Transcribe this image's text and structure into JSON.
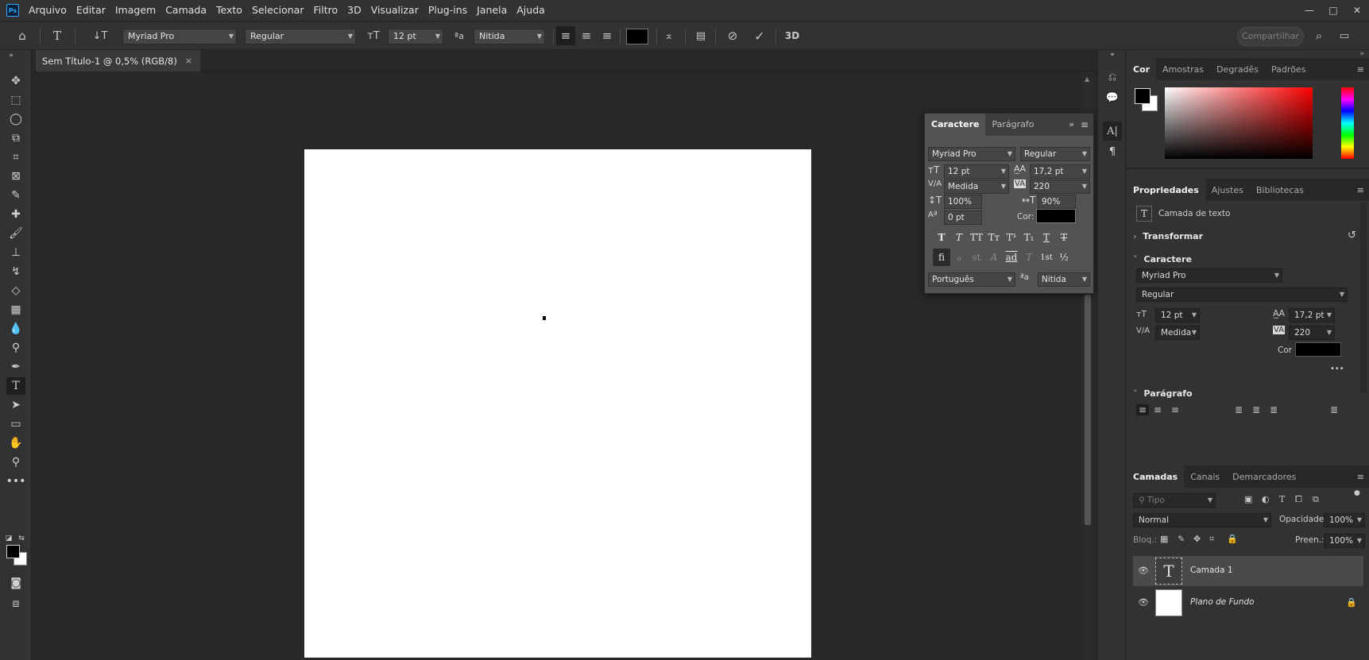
{
  "app": {
    "logo": "Ps"
  },
  "menu": [
    "Arquivo",
    "Editar",
    "Imagem",
    "Camada",
    "Texto",
    "Selecionar",
    "Filtro",
    "3D",
    "Visualizar",
    "Plug-ins",
    "Janela",
    "Ajuda"
  ],
  "window_controls": {
    "minimize": "—",
    "maximize": "□",
    "close": "✕"
  },
  "options_bar": {
    "font_family": "Myriad Pro",
    "font_style": "Regular",
    "font_size": "12 pt",
    "antialias": "Nitida",
    "label_3d": "3D",
    "share_label": "Compartilhar"
  },
  "document": {
    "tab_title": "Sem Título-1 @ 0,5% (RGB/8)",
    "close": "×"
  },
  "char_panel": {
    "tabs": [
      "Caractere",
      "Parágrafo"
    ],
    "font_family": "Myriad Pro",
    "font_style": "Regular",
    "size": "12 pt",
    "leading": "17,2 pt",
    "kerning": "Medida",
    "tracking": "220",
    "vscale": "100%",
    "hscale": "90%",
    "baseline": "0 pt",
    "color_label": "Cor:",
    "style_buttons": [
      "T",
      "T",
      "TT",
      "Tт",
      "T¹",
      "T₁",
      "T",
      "T"
    ],
    "otype_buttons": [
      "fi",
      "ℴ",
      "st",
      "A",
      "ad",
      "T",
      "1st",
      "½"
    ],
    "language": "Português",
    "antialias_icon": "ªa",
    "antialias": "Nitida"
  },
  "color_panel": {
    "tabs": [
      "Cor",
      "Amostras",
      "Degradês",
      "Padrões"
    ]
  },
  "properties_panel": {
    "tabs": [
      "Propriedades",
      "Ajustes",
      "Bibliotecas"
    ],
    "layer_type": "Camada de texto",
    "transform_label": "Transformar",
    "character_label": "Caractere",
    "font_family": "Myriad Pro",
    "font_style": "Regular",
    "size": "12 pt",
    "leading": "17,2 pt",
    "kerning": "Medida",
    "tracking": "220",
    "color_label": "Cor",
    "more": "•••",
    "paragraph_label": "Parágrafo"
  },
  "layers_panel": {
    "tabs": [
      "Camadas",
      "Canais",
      "Demarcadores"
    ],
    "search_placeholder": "Tipo",
    "blend_mode": "Normal",
    "opacity_label": "Opacidade:",
    "opacity": "100%",
    "lock_label": "Bloq.:",
    "fill_label": "Preen.:",
    "fill": "100%",
    "layers": [
      {
        "name": "Camada 1",
        "thumb": "T"
      },
      {
        "name": "Plano de Fundo"
      }
    ]
  }
}
